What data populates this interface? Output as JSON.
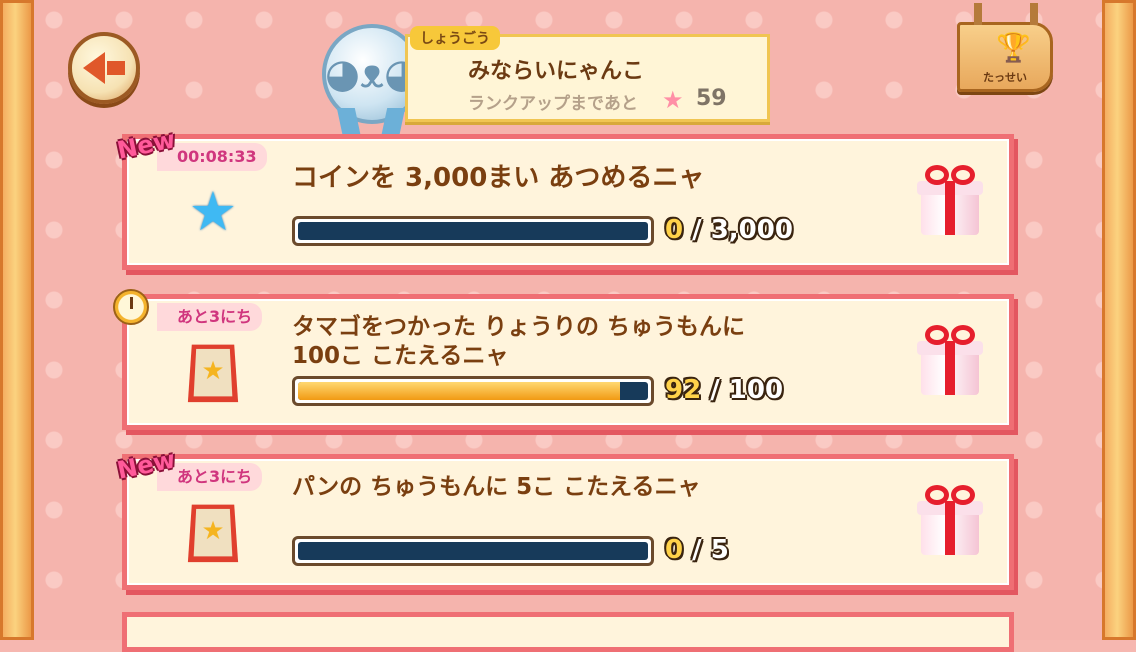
{
  "header": {
    "rank_tag": "しょうごう",
    "rank_title": "みならいにゃんこ",
    "rank_sub": "ランクアップまであと",
    "rank_remaining": "59",
    "achievements_label": "たっせい"
  },
  "missions": [
    {
      "time_label": "00:08:33",
      "is_new": true,
      "new_label": "New",
      "icon": "star-icon",
      "title": "コインを 3,000まい あつめるニャ",
      "current": "0",
      "target": "3,000",
      "progress_fraction": 0
    },
    {
      "time_label": "あと3にち",
      "is_new": false,
      "icon": "signboard-icon",
      "title": "タマゴをつかった りょうりの ちゅうもんに 100こ こたえるニャ",
      "current": "92",
      "target": "100",
      "progress_fraction": 0.92
    },
    {
      "time_label": "あと3にち",
      "is_new": true,
      "new_label": "New",
      "icon": "signboard-icon",
      "title": "パンの ちゅうもんに 5こ こたえるニャ",
      "current": "0",
      "target": "5",
      "progress_fraction": 0
    }
  ],
  "colors": {
    "card_border": "#ef6f74",
    "progress_track": "#173a5a",
    "progress_fill": "#f19a13",
    "title_text": "#7a3f10"
  }
}
